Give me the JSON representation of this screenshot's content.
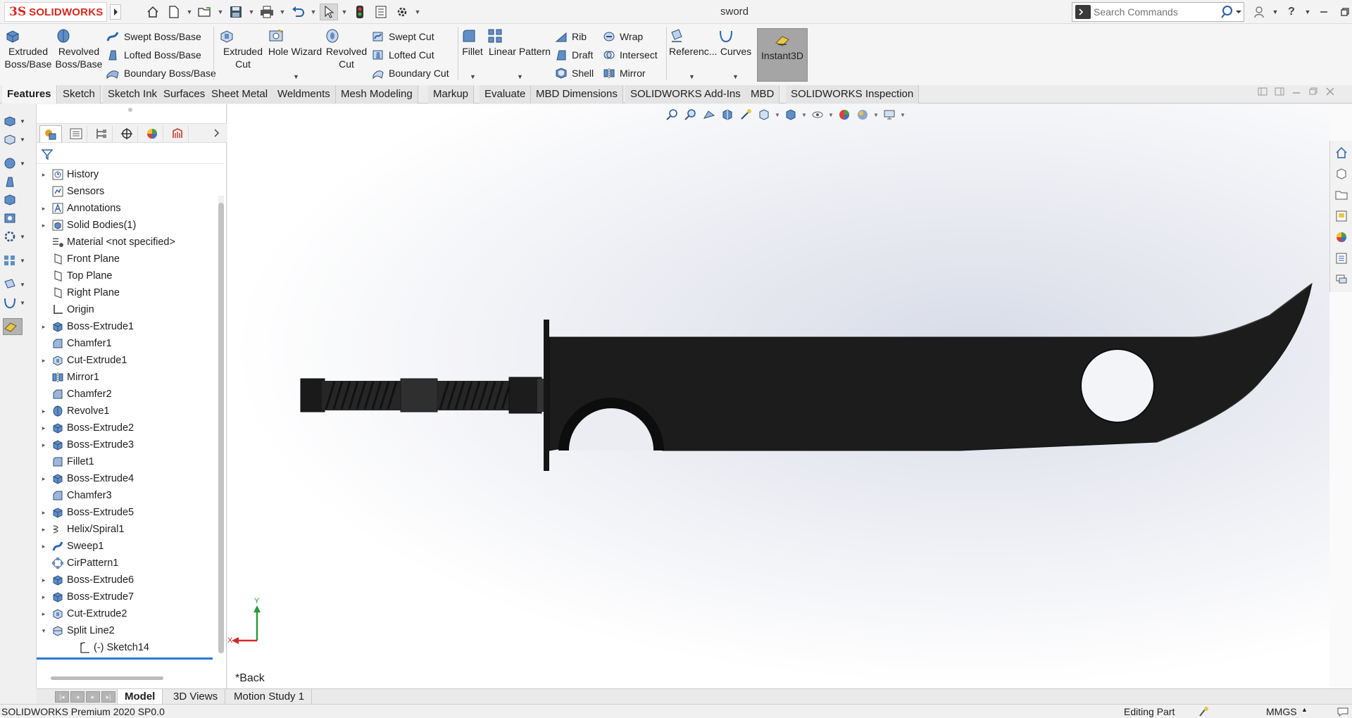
{
  "app": {
    "logo_ds": "3S",
    "logo_text": "SOLIDWORKS",
    "document_title": "sword"
  },
  "search": {
    "placeholder": "Search Commands"
  },
  "ribbon": {
    "extruded_boss": "Extruded Boss/Base",
    "revolved_boss": "Revolved Boss/Base",
    "swept_boss": "Swept Boss/Base",
    "lofted_boss": "Lofted Boss/Base",
    "boundary_boss": "Boundary Boss/Base",
    "extruded_cut": "Extruded Cut",
    "hole_wizard": "Hole Wizard",
    "revolved_cut": "Revolved Cut",
    "swept_cut": "Swept Cut",
    "lofted_cut": "Lofted Cut",
    "boundary_cut": "Boundary Cut",
    "fillet": "Fillet",
    "linear_pattern": "Linear Pattern",
    "rib": "Rib",
    "draft": "Draft",
    "shell": "Shell",
    "wrap": "Wrap",
    "intersect": "Intersect",
    "mirror": "Mirror",
    "reference": "Referenc...",
    "curves": "Curves",
    "instant3d": "Instant3D"
  },
  "tabs": [
    "Features",
    "Sketch",
    "Sketch Ink",
    "Surfaces",
    "Sheet Metal",
    "Weldments",
    "Mesh Modeling",
    "Markup",
    "Evaluate",
    "MBD Dimensions",
    "SOLIDWORKS Add-Ins",
    "MBD",
    "SOLIDWORKS Inspection"
  ],
  "tree": [
    {
      "label": "History",
      "icon": "history-icon",
      "expandable": true
    },
    {
      "label": "Sensors",
      "icon": "sensor-icon",
      "expandable": false
    },
    {
      "label": "Annotations",
      "icon": "annotation-icon",
      "expandable": true
    },
    {
      "label": "Solid Bodies(1)",
      "icon": "solid-bodies-icon",
      "expandable": true
    },
    {
      "label": "Material <not specified>",
      "icon": "material-icon",
      "expandable": false
    },
    {
      "label": "Front Plane",
      "icon": "plane-icon",
      "expandable": false
    },
    {
      "label": "Top Plane",
      "icon": "plane-icon",
      "expandable": false
    },
    {
      "label": "Right Plane",
      "icon": "plane-icon",
      "expandable": false
    },
    {
      "label": "Origin",
      "icon": "origin-icon",
      "expandable": false
    },
    {
      "label": "Boss-Extrude1",
      "icon": "boss-extrude-icon",
      "expandable": true
    },
    {
      "label": "Chamfer1",
      "icon": "chamfer-icon",
      "expandable": false
    },
    {
      "label": "Cut-Extrude1",
      "icon": "cut-extrude-icon",
      "expandable": true
    },
    {
      "label": "Mirror1",
      "icon": "mirror-icon",
      "expandable": false
    },
    {
      "label": "Chamfer2",
      "icon": "chamfer-icon",
      "expandable": false
    },
    {
      "label": "Revolve1",
      "icon": "revolve-icon",
      "expandable": true
    },
    {
      "label": "Boss-Extrude2",
      "icon": "boss-extrude-icon",
      "expandable": true
    },
    {
      "label": "Boss-Extrude3",
      "icon": "boss-extrude-icon",
      "expandable": true
    },
    {
      "label": "Fillet1",
      "icon": "fillet-icon",
      "expandable": false
    },
    {
      "label": "Boss-Extrude4",
      "icon": "boss-extrude-icon",
      "expandable": true
    },
    {
      "label": "Chamfer3",
      "icon": "chamfer-icon",
      "expandable": false
    },
    {
      "label": "Boss-Extrude5",
      "icon": "boss-extrude-icon",
      "expandable": true
    },
    {
      "label": "Helix/Spiral1",
      "icon": "helix-icon",
      "expandable": true
    },
    {
      "label": "Sweep1",
      "icon": "sweep-icon",
      "expandable": true
    },
    {
      "label": "CirPattern1",
      "icon": "circular-pattern-icon",
      "expandable": false
    },
    {
      "label": "Boss-Extrude6",
      "icon": "boss-extrude-icon",
      "expandable": true
    },
    {
      "label": "Boss-Extrude7",
      "icon": "boss-extrude-icon",
      "expandable": true
    },
    {
      "label": "Cut-Extrude2",
      "icon": "cut-extrude-icon",
      "expandable": true
    },
    {
      "label": "Split Line2",
      "icon": "split-line-icon",
      "expandable": true,
      "expanded": true
    },
    {
      "label": "(-) Sketch14",
      "icon": "sketch-icon",
      "expandable": false,
      "child": true
    }
  ],
  "viewport": {
    "view_name": "*Back",
    "triad_y": "Y",
    "triad_x": "X"
  },
  "bottom_tabs": [
    "Model",
    "3D Views",
    "Motion Study 1"
  ],
  "status": {
    "version": "SOLIDWORKS Premium 2020 SP0.0",
    "mode": "Editing Part",
    "units": "MMGS"
  },
  "colors": {
    "accent": "#d7281d",
    "selection": "#2a7ad5",
    "model": "#1c1c1c"
  }
}
